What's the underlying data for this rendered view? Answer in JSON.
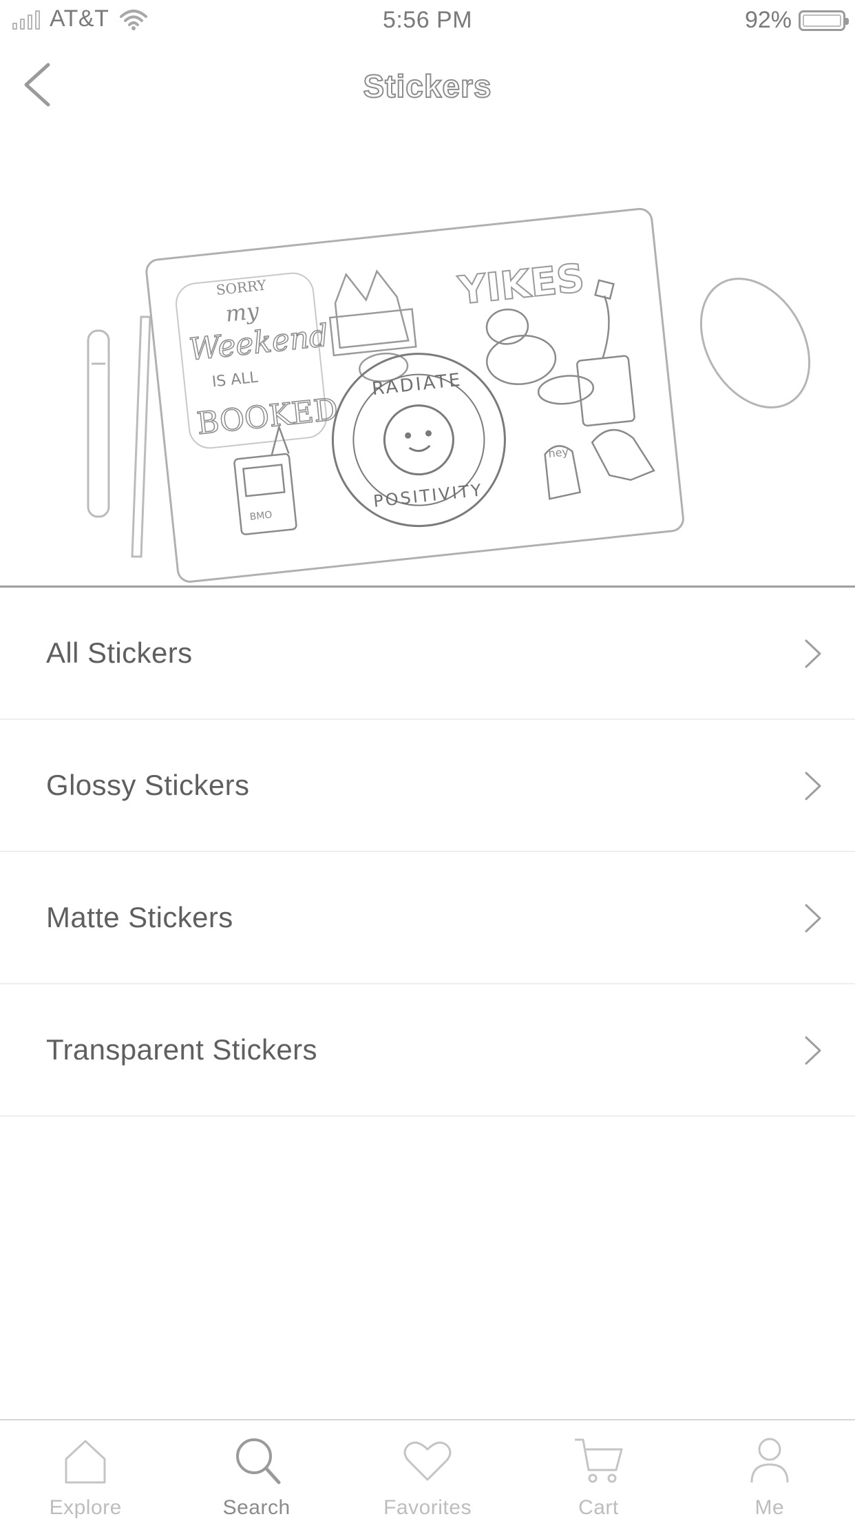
{
  "status_bar": {
    "carrier": "AT&T",
    "time": "5:56 PM",
    "battery": "92%",
    "battery_level": 0.92
  },
  "nav": {
    "title": "Stickers",
    "back_icon": "chevron-left-icon"
  },
  "hero": {
    "sticker_texts": [
      "SORRY",
      "my",
      "Weekend",
      "IS ALL",
      "BOOKED",
      "YIKES",
      "RADIATE",
      "POSITIVITY",
      "BMO",
      "hey"
    ]
  },
  "list": {
    "items": [
      {
        "label": "All Stickers"
      },
      {
        "label": "Glossy Stickers"
      },
      {
        "label": "Matte Stickers"
      },
      {
        "label": "Transparent Stickers"
      }
    ]
  },
  "tab_bar": {
    "tabs": [
      {
        "label": "Explore",
        "icon": "home-icon",
        "active": false
      },
      {
        "label": "Search",
        "icon": "search-icon",
        "active": true
      },
      {
        "label": "Favorites",
        "icon": "heart-icon",
        "active": false
      },
      {
        "label": "Cart",
        "icon": "cart-icon",
        "active": false
      },
      {
        "label": "Me",
        "icon": "person-icon",
        "active": false
      }
    ]
  },
  "colors": {
    "text": "#5f5f5f",
    "muted": "#bdbdbd",
    "divider": "#eeeeee"
  }
}
